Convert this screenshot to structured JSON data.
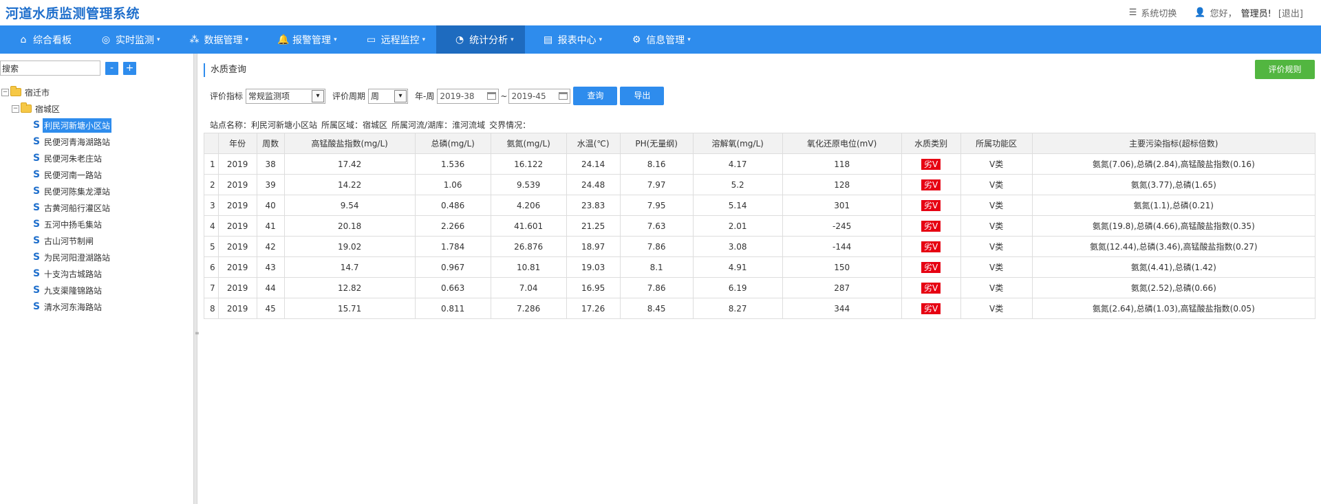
{
  "header": {
    "title": "河道水质监测管理系统",
    "switch_label": "系统切换",
    "greeting": "您好，",
    "username": "管理员!",
    "logout": "[退出]"
  },
  "nav": [
    {
      "label": "综合看板",
      "icon": "home-icon",
      "caret": false
    },
    {
      "label": "实时监测",
      "icon": "globe-icon",
      "caret": true
    },
    {
      "label": "数据管理",
      "icon": "share-icon",
      "caret": true
    },
    {
      "label": "报警管理",
      "icon": "bell-icon",
      "caret": true
    },
    {
      "label": "远程监控",
      "icon": "monitor-icon",
      "caret": true
    },
    {
      "label": "统计分析",
      "icon": "pie-icon",
      "caret": true,
      "active": true
    },
    {
      "label": "报表中心",
      "icon": "report-icon",
      "caret": true
    },
    {
      "label": "信息管理",
      "icon": "gear-icon",
      "caret": true
    }
  ],
  "sidebar": {
    "search_value": "搜索",
    "minus": "-",
    "plus": "+",
    "city": "宿迁市",
    "district": "宿城区",
    "stations": [
      "利民河新塘小区站",
      "民便河青海湖路站",
      "民便河朱老庄站",
      "民便河南一路站",
      "民便河陈集龙潭站",
      "古黄河船行灌区站",
      "五河中扬毛集站",
      "古山河节制闸",
      "为民河阳澄湖路站",
      "十支沟古城路站",
      "九支渠隆锦路站",
      "清水河东海路站"
    ]
  },
  "main": {
    "title": "水质查询",
    "rule_button": "评价规则",
    "filters": {
      "indicator_label": "评价指标",
      "indicator_value": "常规监测项",
      "period_label": "评价周期",
      "period_value": "周",
      "range_label": "年-周",
      "start": "2019-38",
      "tilde": "~",
      "end": "2019-45",
      "query": "查询",
      "export": "导出"
    },
    "info": {
      "station": "站点名称：利民河新塘小区站",
      "area": "所属区域：宿城区",
      "river": "所属河流/湖库：淮河流域",
      "boundary": "交界情况："
    },
    "table": {
      "headers": [
        "",
        "年份",
        "周数",
        "高锰酸盐指数(mg/L)",
        "总磷(mg/L)",
        "氨氮(mg/L)",
        "水温(℃)",
        "PH(无量纲)",
        "溶解氧(mg/L)",
        "氧化还原电位(mV)",
        "水质类别",
        "所属功能区",
        "主要污染指标(超标倍数)"
      ],
      "rows": [
        [
          "1",
          "2019",
          "38",
          "17.42",
          "1.536",
          "16.122",
          "24.14",
          "8.16",
          "4.17",
          "118",
          "劣Ⅴ",
          "Ⅴ类",
          "氨氮(7.06),总磷(2.84),高锰酸盐指数(0.16)"
        ],
        [
          "2",
          "2019",
          "39",
          "14.22",
          "1.06",
          "9.539",
          "24.48",
          "7.97",
          "5.2",
          "128",
          "劣Ⅴ",
          "Ⅴ类",
          "氨氮(3.77),总磷(1.65)"
        ],
        [
          "3",
          "2019",
          "40",
          "9.54",
          "0.486",
          "4.206",
          "23.83",
          "7.95",
          "5.14",
          "301",
          "劣Ⅴ",
          "Ⅴ类",
          "氨氮(1.1),总磷(0.21)"
        ],
        [
          "4",
          "2019",
          "41",
          "20.18",
          "2.266",
          "41.601",
          "21.25",
          "7.63",
          "2.01",
          "-245",
          "劣Ⅴ",
          "Ⅴ类",
          "氨氮(19.8),总磷(4.66),高锰酸盐指数(0.35)"
        ],
        [
          "5",
          "2019",
          "42",
          "19.02",
          "1.784",
          "26.876",
          "18.97",
          "7.86",
          "3.08",
          "-144",
          "劣Ⅴ",
          "Ⅴ类",
          "氨氮(12.44),总磷(3.46),高锰酸盐指数(0.27)"
        ],
        [
          "6",
          "2019",
          "43",
          "14.7",
          "0.967",
          "10.81",
          "19.03",
          "8.1",
          "4.91",
          "150",
          "劣Ⅴ",
          "Ⅴ类",
          "氨氮(4.41),总磷(1.42)"
        ],
        [
          "7",
          "2019",
          "44",
          "12.82",
          "0.663",
          "7.04",
          "16.95",
          "7.86",
          "6.19",
          "287",
          "劣Ⅴ",
          "Ⅴ类",
          "氨氮(2.52),总磷(0.66)"
        ],
        [
          "8",
          "2019",
          "45",
          "15.71",
          "0.811",
          "7.286",
          "17.26",
          "8.45",
          "8.27",
          "344",
          "劣Ⅴ",
          "Ⅴ类",
          "氨氮(2.64),总磷(1.03),高锰酸盐指数(0.05)"
        ]
      ]
    }
  },
  "colors": {
    "primary": "#2e8ced",
    "nav_active": "#1e6bbf",
    "success": "#52b640",
    "badge_red": "#e60012"
  }
}
